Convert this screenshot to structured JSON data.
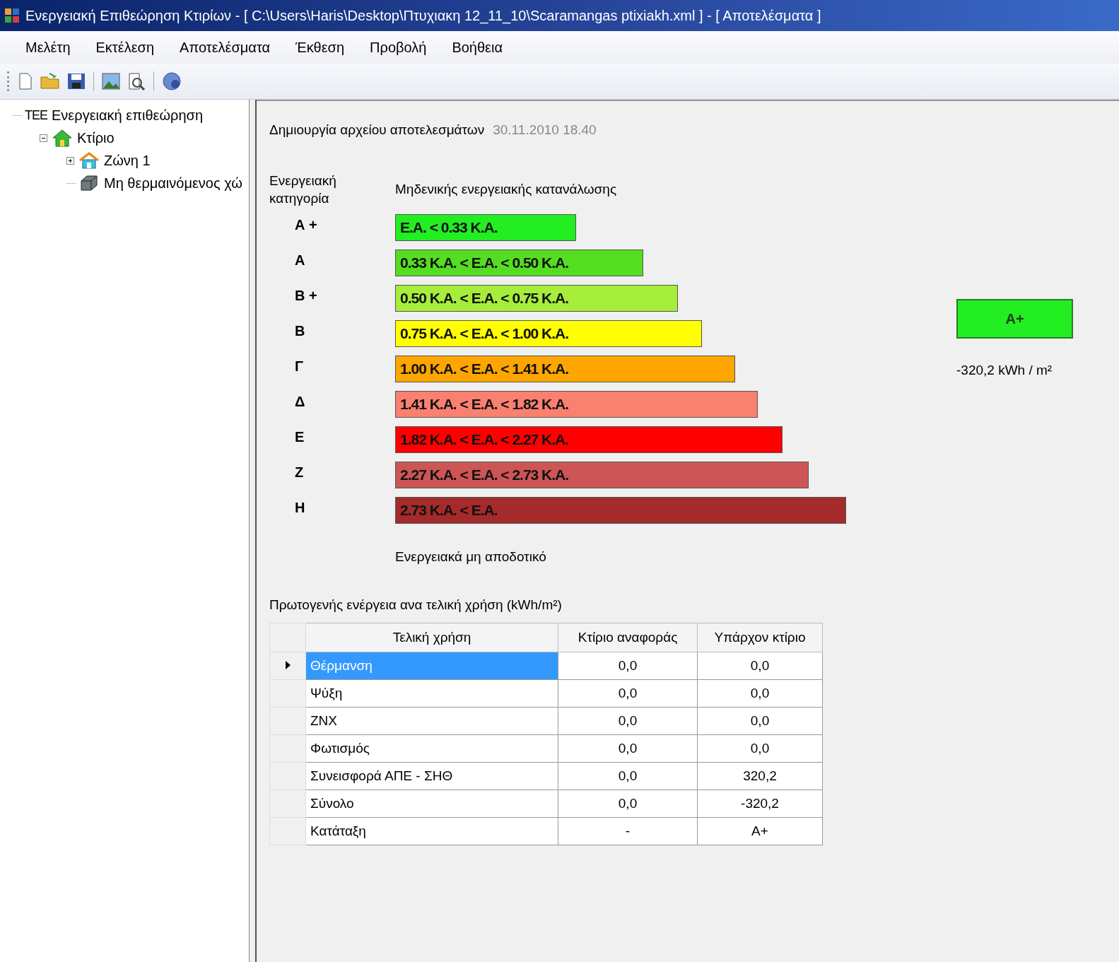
{
  "window": {
    "title": "Ενεργειακή Επιθεώρηση Κτιρίων - [ C:\\Users\\Haris\\Desktop\\Πτυχιακη 12_11_10\\Scaramangas ptixiakh.xml ] - [ Αποτελέσματα ]"
  },
  "menu": [
    "Μελέτη",
    "Εκτέλεση",
    "Αποτελέσματα",
    "Έκθεση",
    "Προβολή",
    "Βοήθεια"
  ],
  "tree": [
    {
      "kind": "tee",
      "badge": "ΤΕΕ",
      "label": "Ενεργειακή επιθεώρηση",
      "children": [
        {
          "kind": "house",
          "label": "Κτίριο",
          "expanded": true,
          "children": [
            {
              "kind": "zone",
              "label": "Ζώνη 1",
              "expanded": false
            },
            {
              "kind": "space",
              "label": "Μη θερμαινόμενος χώ"
            }
          ]
        }
      ]
    }
  ],
  "results": {
    "created_label": "Δημιουργία αρχείου αποτελεσμάτων",
    "created_value": "30.11.2010 18.40",
    "category_header": "Ενεργειακή κατηγορία",
    "top_label": "Μηδενικής ενεργειακής κατανάλωσης",
    "bottom_label": "Ενεργειακά μη αποδοτικό",
    "classes": [
      {
        "letter": "Α +",
        "range": "Ε.Α. < 0.33 Κ.Α.",
        "color": "#22ee22"
      },
      {
        "letter": "Α",
        "range": "0.33 Κ.Α. < Ε.Α. < 0.50 Κ.Α.",
        "color": "#55dd22"
      },
      {
        "letter": "Β +",
        "range": "0.50 Κ.Α. < Ε.Α. < 0.75 Κ.Α.",
        "color": "#a6ee3a"
      },
      {
        "letter": "Β",
        "range": "0.75 Κ.Α. < Ε.Α. < 1.00 Κ.Α.",
        "color": "#ffff00"
      },
      {
        "letter": "Γ",
        "range": "1.00 Κ.Α. < Ε.Α. < 1.41 Κ.Α.",
        "color": "#ffa500"
      },
      {
        "letter": "Δ",
        "range": "1.41 Κ.Α. < Ε.Α. < 1.82 Κ.Α.",
        "color": "#fa8070"
      },
      {
        "letter": "Ε",
        "range": "1.82 Κ.Α. < Ε.Α. < 2.27 Κ.Α.",
        "color": "#ff0000"
      },
      {
        "letter": "Ζ",
        "range": "2.27 Κ.Α. < Ε.Α. < 2.73 Κ.Α.",
        "color": "#cd5555"
      },
      {
        "letter": "Η",
        "range": "2.73 Κ.Α. < Ε.Α.",
        "color": "#a52a2a"
      }
    ],
    "rating": {
      "label": "A+",
      "color": "#22ee22",
      "value": "-320,2 kWh / m²"
    }
  },
  "table": {
    "title": "Πρωτογενής ενέργεια ανα τελική χρήση (kWh/m²)",
    "columns": [
      "Τελική χρήση",
      "Κτίριο αναφοράς",
      "Υπάρχον κτίριο"
    ],
    "rows": [
      {
        "selected": true,
        "cells": [
          "Θέρμανση",
          "0,0",
          "0,0"
        ]
      },
      {
        "selected": false,
        "cells": [
          "Ψύξη",
          "0,0",
          "0,0"
        ]
      },
      {
        "selected": false,
        "cells": [
          "ΖΝΧ",
          "0,0",
          "0,0"
        ]
      },
      {
        "selected": false,
        "cells": [
          "Φωτισμός",
          "0,0",
          "0,0"
        ]
      },
      {
        "selected": false,
        "cells": [
          "Συνεισφορά ΑΠΕ - ΣΗΘ",
          "0,0",
          "320,2"
        ]
      },
      {
        "selected": false,
        "cells": [
          "Σύνολο",
          "0,0",
          "-320,2"
        ]
      },
      {
        "selected": false,
        "cells": [
          "Κατάταξη",
          "-",
          "A+"
        ]
      }
    ]
  }
}
